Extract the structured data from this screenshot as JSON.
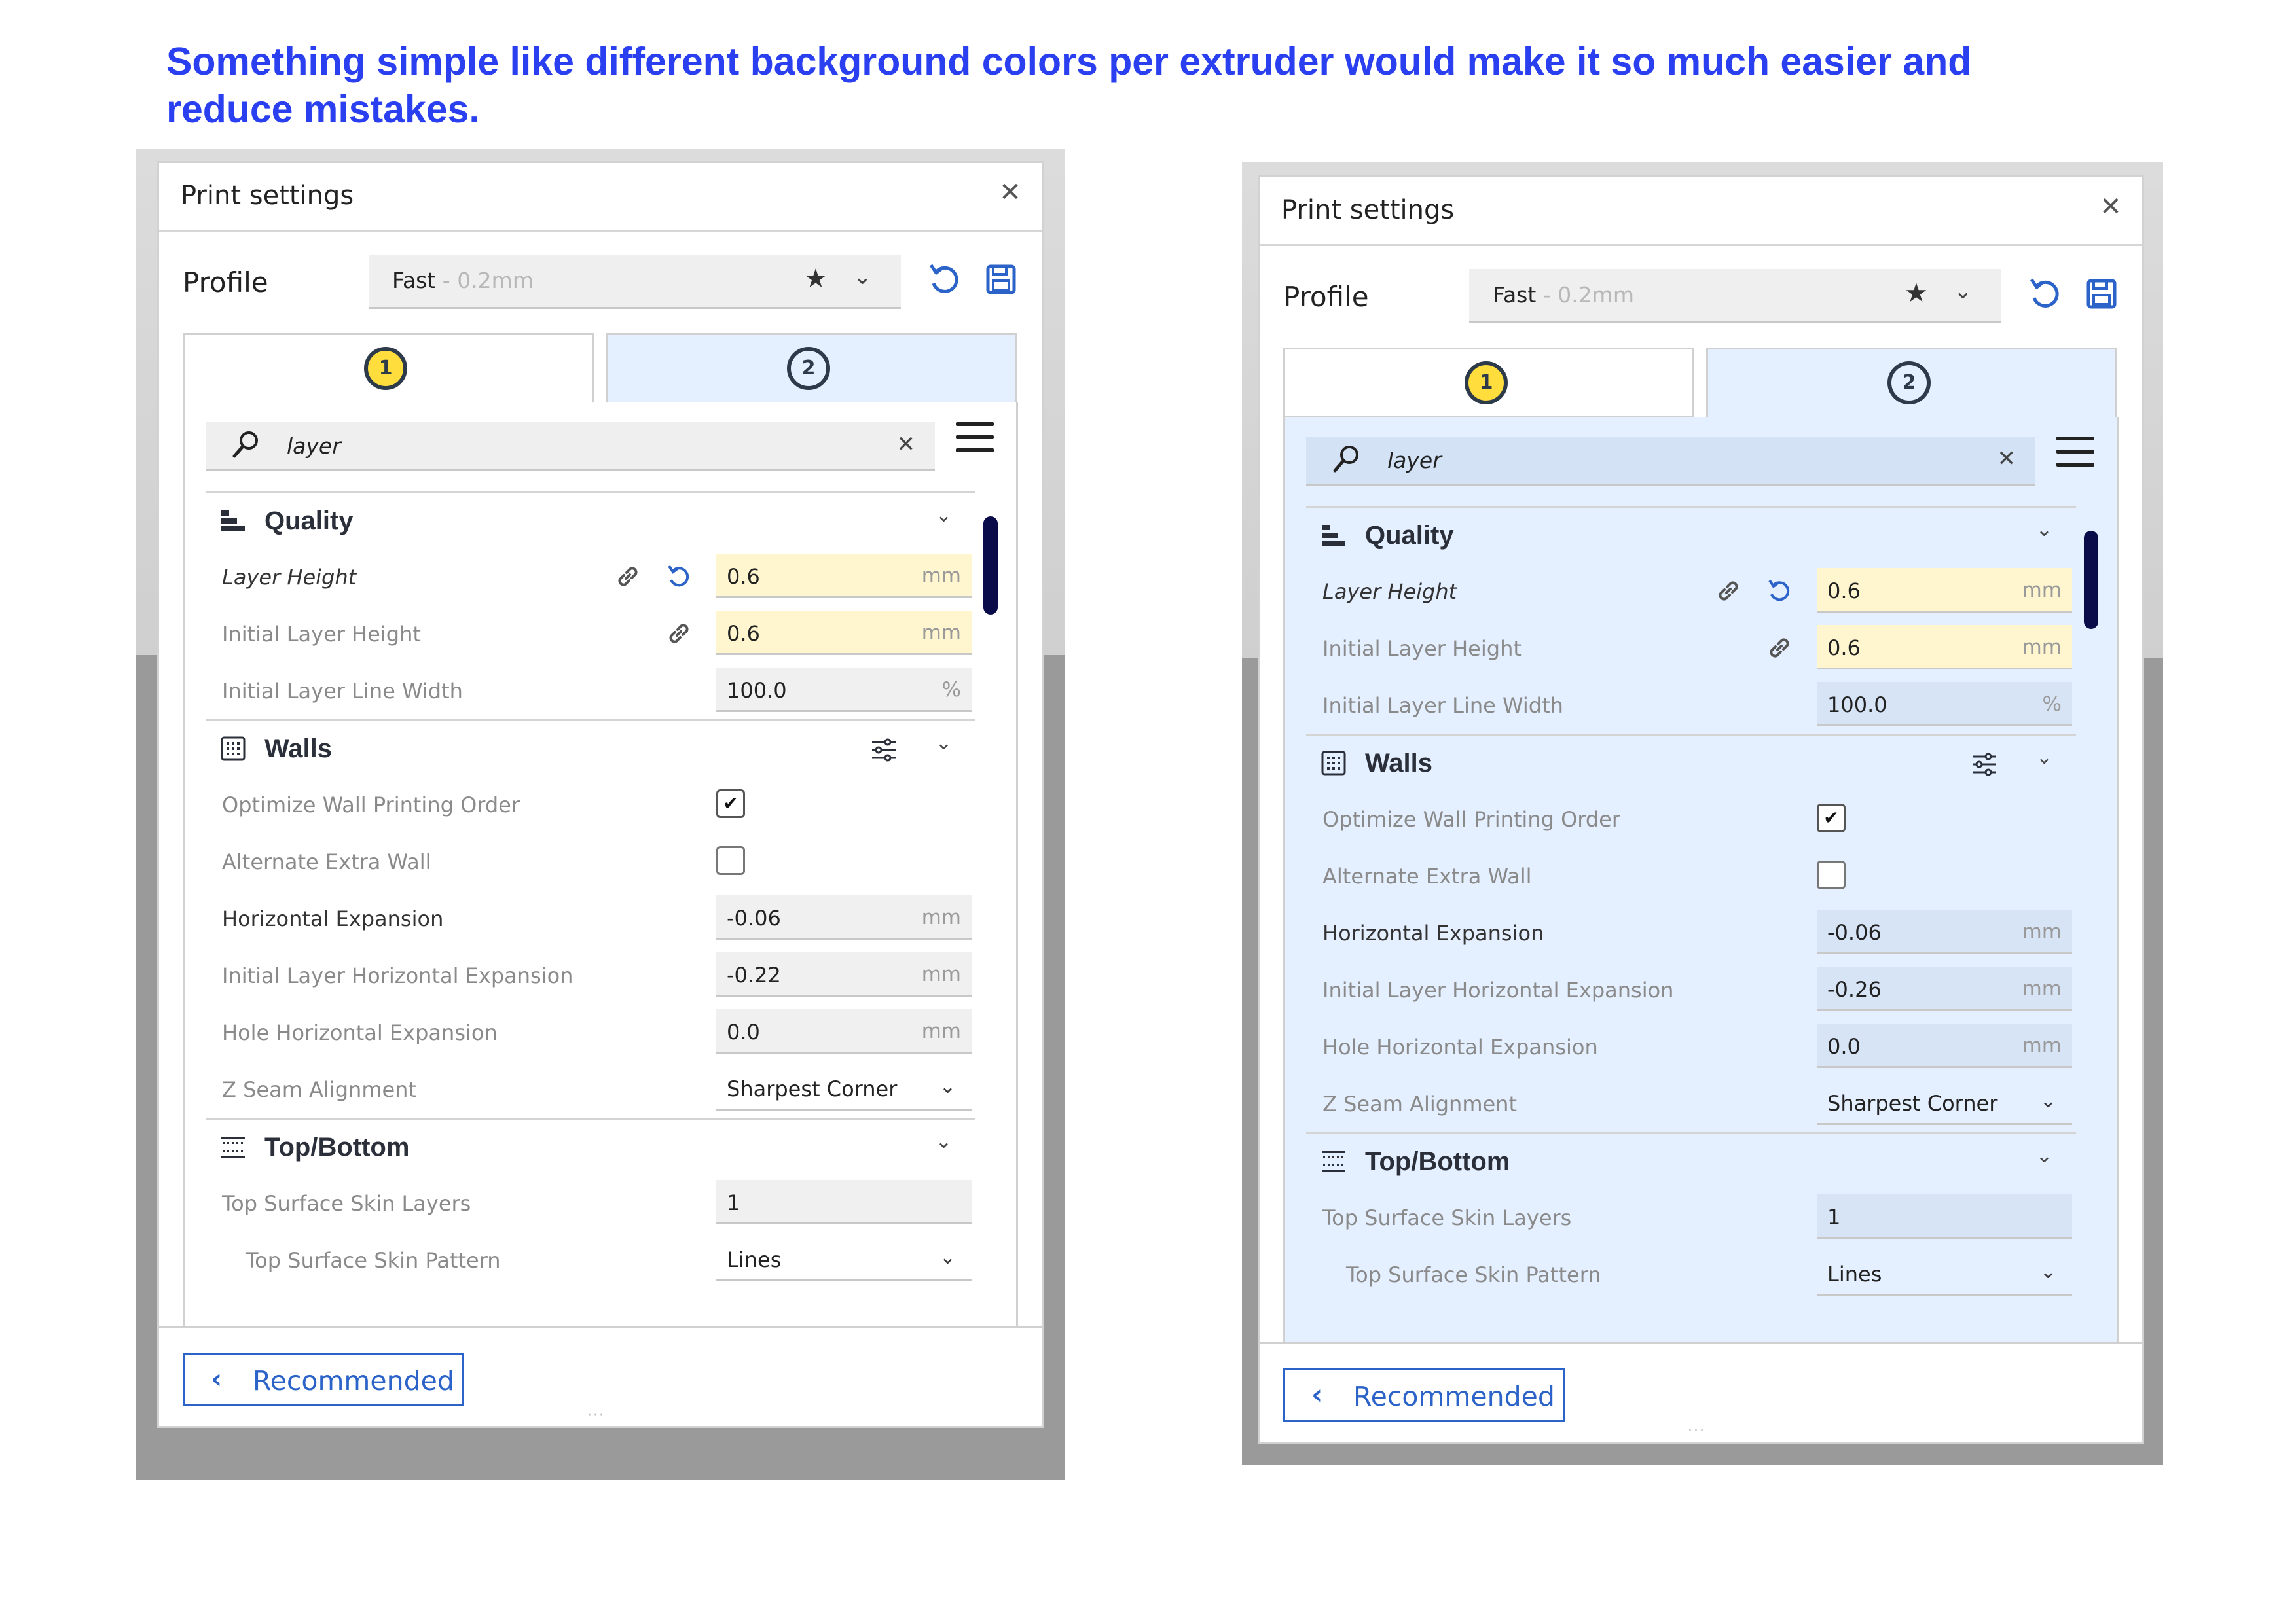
{
  "caption": "Something simple like different background colors per extruder would make it so much easier and reduce mistakes.",
  "colors": {
    "caption": "#2a3ff0",
    "accent": "#2b63c8",
    "tab_blue": "#e4efff",
    "highlight_yellow": "#fff6cf",
    "extruder1_badge": "#ffdd3d"
  },
  "panels": [
    {
      "title": "Print settings",
      "close_icon": "close-icon",
      "profile": {
        "label": "Profile",
        "name": "Fast",
        "detail": " - 0.2mm"
      },
      "tabs": [
        {
          "number": "1"
        },
        {
          "number": "2"
        }
      ],
      "active_tab": 1,
      "search": {
        "value": "layer"
      },
      "quality": {
        "title": "Quality",
        "layer_height": {
          "label": "Layer Height",
          "value": "0.6",
          "unit": "mm"
        },
        "initial_layer_height": {
          "label": "Initial Layer Height",
          "value": "0.6",
          "unit": "mm"
        },
        "initial_layer_line_width": {
          "label": "Initial Layer Line Width",
          "value": "100.0",
          "unit": "%"
        }
      },
      "walls": {
        "title": "Walls",
        "optimize_wall_order": {
          "label": "Optimize Wall Printing Order",
          "checked": true,
          "mark": "✔"
        },
        "alternate_extra_wall": {
          "label": "Alternate Extra Wall",
          "checked": false
        },
        "horizontal_expansion": {
          "label": "Horizontal Expansion",
          "value": "-0.06",
          "unit": "mm"
        },
        "initial_layer_horizontal_expansion": {
          "label": "Initial Layer Horizontal Expansion",
          "value": "-0.22",
          "unit": "mm"
        },
        "hole_horizontal_expansion": {
          "label": "Hole Horizontal Expansion",
          "value": "0.0",
          "unit": "mm"
        },
        "z_seam_alignment": {
          "label": "Z Seam Alignment",
          "value": "Sharpest Corner"
        }
      },
      "top_bottom": {
        "title": "Top/Bottom",
        "top_surface_skin_layers": {
          "label": "Top Surface Skin Layers",
          "value": "1"
        },
        "top_surface_skin_pattern": {
          "label": "Top Surface Skin Pattern",
          "value": "Lines"
        }
      },
      "footer": {
        "recommended": "Recommended"
      }
    },
    {
      "title": "Print settings",
      "close_icon": "close-icon",
      "profile": {
        "label": "Profile",
        "name": "Fast",
        "detail": " - 0.2mm"
      },
      "tabs": [
        {
          "number": "1"
        },
        {
          "number": "2"
        }
      ],
      "active_tab": 2,
      "search": {
        "value": "layer"
      },
      "quality": {
        "title": "Quality",
        "layer_height": {
          "label": "Layer Height",
          "value": "0.6",
          "unit": "mm"
        },
        "initial_layer_height": {
          "label": "Initial Layer Height",
          "value": "0.6",
          "unit": "mm"
        },
        "initial_layer_line_width": {
          "label": "Initial Layer Line Width",
          "value": "100.0",
          "unit": "%"
        }
      },
      "walls": {
        "title": "Walls",
        "optimize_wall_order": {
          "label": "Optimize Wall Printing Order",
          "checked": true,
          "mark": "✔"
        },
        "alternate_extra_wall": {
          "label": "Alternate Extra Wall",
          "checked": false
        },
        "horizontal_expansion": {
          "label": "Horizontal Expansion",
          "value": "-0.06",
          "unit": "mm"
        },
        "initial_layer_horizontal_expansion": {
          "label": "Initial Layer Horizontal Expansion",
          "value": "-0.26",
          "unit": "mm"
        },
        "hole_horizontal_expansion": {
          "label": "Hole Horizontal Expansion",
          "value": "0.0",
          "unit": "mm"
        },
        "z_seam_alignment": {
          "label": "Z Seam Alignment",
          "value": "Sharpest Corner"
        }
      },
      "top_bottom": {
        "title": "Top/Bottom",
        "top_surface_skin_layers": {
          "label": "Top Surface Skin Layers",
          "value": "1"
        },
        "top_surface_skin_pattern": {
          "label": "Top Surface Skin Pattern",
          "value": "Lines"
        }
      },
      "footer": {
        "recommended": "Recommended"
      }
    }
  ]
}
